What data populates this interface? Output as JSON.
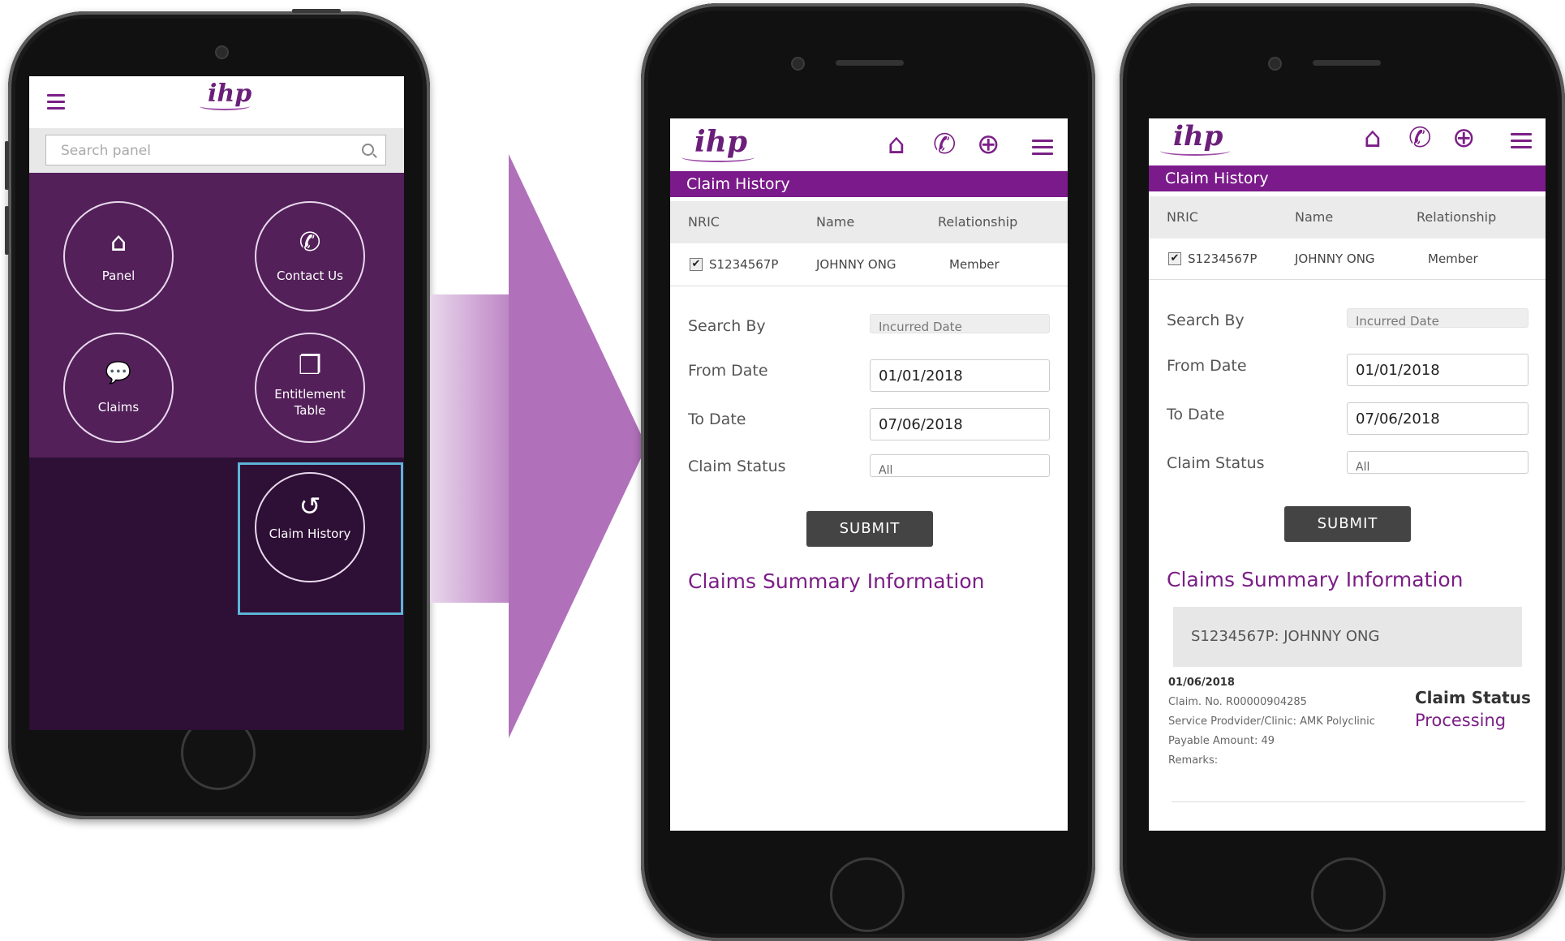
{
  "screen1": {
    "search_placeholder": "Search panel",
    "menu": [
      {
        "label": "Panel",
        "icon": "home-plus-icon"
      },
      {
        "label": "Contact Us",
        "icon": "phone-icon"
      },
      {
        "label": "Claims",
        "icon": "chat-bubble-icon"
      },
      {
        "label": "Entitlement Table",
        "icon": "documents-icon"
      },
      {
        "label": "Claim History",
        "icon": "history-icon"
      }
    ]
  },
  "claim_screen": {
    "logo": "ihp",
    "title": "Claim History",
    "table": {
      "headers": [
        "NRIC",
        "Name",
        "Relationship"
      ],
      "row": {
        "nric": "S1234567P",
        "name": "JOHNNY ONG",
        "relationship": "Member",
        "checked": true
      }
    },
    "form": {
      "search_by_label": "Search By",
      "search_by_value": "Incurred Date",
      "from_label": "From Date",
      "from_value": "01/01/2018",
      "to_label": "To Date",
      "to_value": "07/06/2018",
      "status_label": "Claim Status",
      "status_value": "All"
    },
    "submit": "SUBMIT",
    "summary_title": "Claims Summary Information"
  },
  "result": {
    "member": "S1234567P: JOHNNY ONG",
    "date": "01/06/2018",
    "claim_no": "Claim. No. R00000904285",
    "provider": "Service Prodvider/Clinic: AMK Polyclinic",
    "amount": "Payable Amount: 49",
    "remarks": "Remarks:",
    "status_label": "Claim Status",
    "status_value": "Processing"
  },
  "colors": {
    "accent": "#7b1f86",
    "menu_bg": "#53205a",
    "highlight": "#5db5d8"
  }
}
